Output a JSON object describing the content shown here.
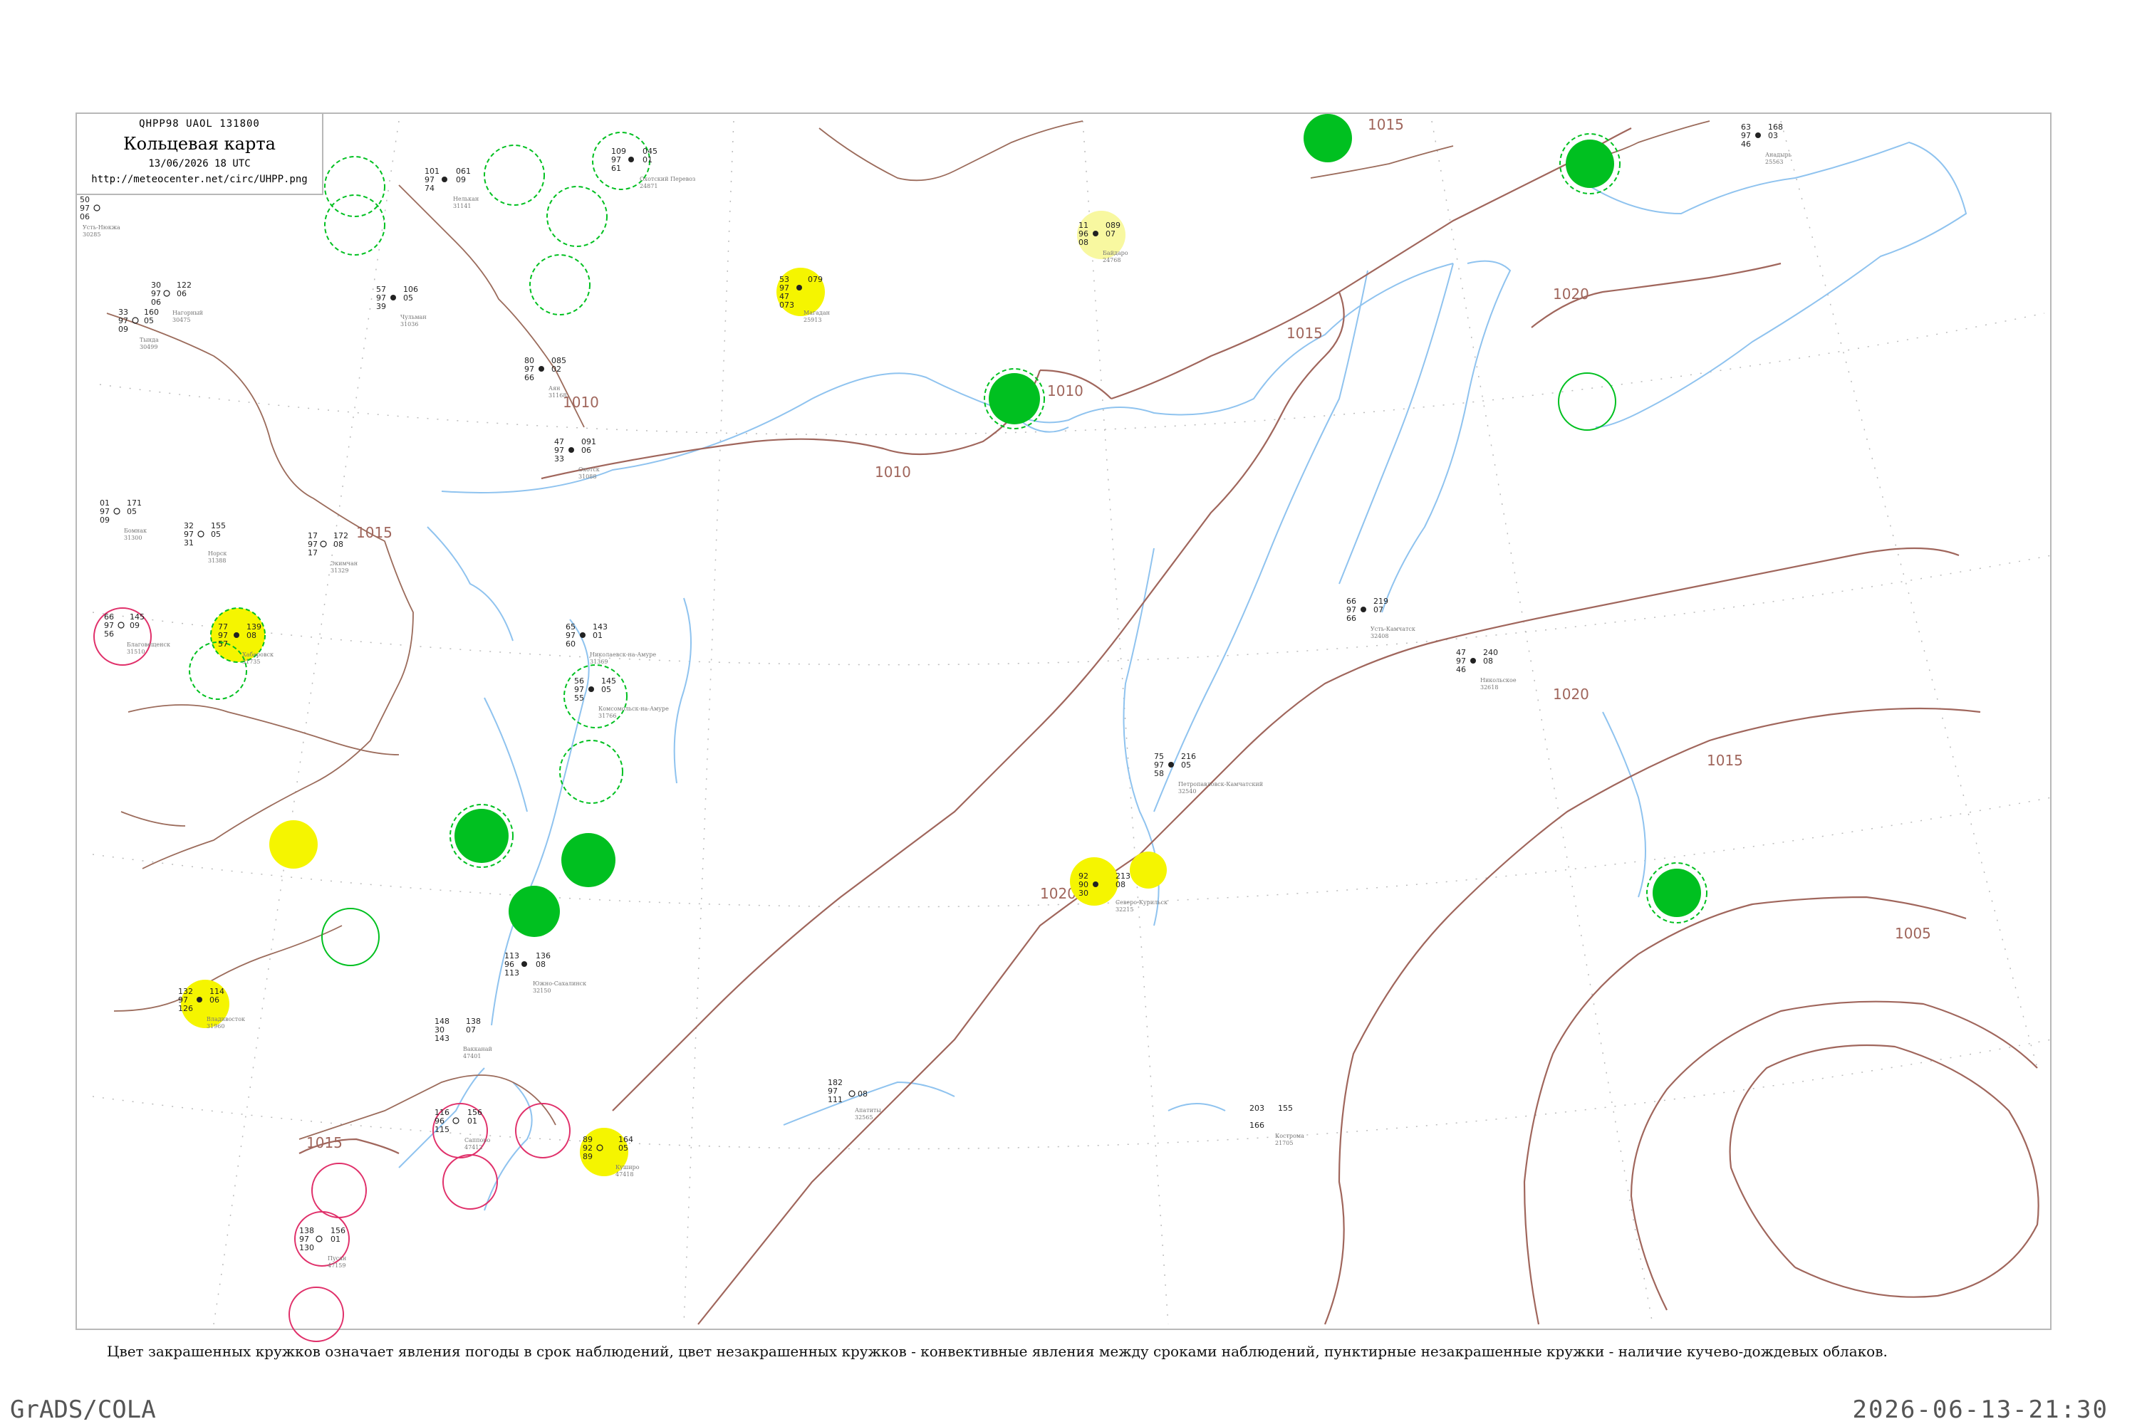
{
  "title": {
    "code": "QHPP98  UAOL  131800",
    "main": "Кольцевая карта",
    "date": "13/06/2026 18 UTC",
    "url": "http://meteocenter.net/circ/UHPP.png"
  },
  "legend_note": "Цвет закрашенных кружков означает явления погоды в срок наблюдений, цвет незакрашенных кружков - конвективные явления между сроками наблюдений, пунктирные незакрашенные кружки - наличие кучево-дождевых облаков.",
  "footer": {
    "left": "GrADS/COLA",
    "right": "2026-06-13-21:30"
  },
  "colors": {
    "isobar": "#a0665c",
    "coast": "#8fc3ef",
    "rain": "#00c020",
    "fog": "#f5f500",
    "haze": "#f8f8a0",
    "thunder": "#e0306a",
    "grid": "#aaaaaa"
  },
  "isobar_labels": [
    "1010",
    "1010",
    "1010",
    "1015",
    "1015",
    "1015",
    "1020",
    "1020",
    "1020",
    "1005",
    "1015",
    "1015"
  ],
  "stations": [
    {
      "name": "Усть-Нюкжа",
      "id": "30285",
      "vals": [
        "50",
        "97",
        "06"
      ],
      "mark": "none"
    },
    {
      "name": "Тында",
      "id": "30499",
      "vals": [
        "33",
        "97",
        "09",
        "160",
        "05"
      ],
      "mark": "none"
    },
    {
      "name": "Нагорный",
      "id": "30475",
      "vals": [
        "30",
        "97",
        "06",
        "122",
        "06"
      ],
      "mark": "none"
    },
    {
      "name": "Нелькан",
      "id": "31141",
      "vals": [
        "101",
        "97",
        "74",
        "061",
        "09"
      ],
      "mark": "none"
    },
    {
      "name": "Чульман",
      "id": "31036",
      "vals": [
        "57",
        "97",
        "39",
        "106",
        "05"
      ],
      "mark": "none"
    },
    {
      "name": "Аян",
      "id": "31168",
      "vals": [
        "80",
        "97",
        "66",
        "085",
        "02"
      ],
      "mark": "none"
    },
    {
      "name": "Охотск",
      "id": "31088",
      "vals": [
        "47",
        "97",
        "33",
        "091",
        "06"
      ],
      "mark": "none"
    },
    {
      "name": "Магадан",
      "id": "25913",
      "vals": [
        "53",
        "97",
        "47",
        "079",
        "073"
      ],
      "mark": "fog"
    },
    {
      "name": "Байдаро",
      "id": "24768",
      "vals": [
        "11",
        "96",
        "08",
        "089",
        "07"
      ],
      "mark": "haze"
    },
    {
      "name": "Экимчан",
      "id": "31329",
      "vals": [
        "17",
        "97",
        "17",
        "172",
        "08"
      ],
      "mark": "none"
    },
    {
      "name": "Бомнак",
      "id": "31300",
      "vals": [
        "01",
        "97",
        "09",
        "171",
        "05"
      ],
      "mark": "none"
    },
    {
      "name": "Норск",
      "id": "31388",
      "vals": [
        "32",
        "97",
        "31",
        "155",
        "05"
      ],
      "mark": "none"
    },
    {
      "name": "Благовещенск",
      "id": "31510",
      "vals": [
        "66",
        "97",
        "56",
        "145",
        "09"
      ],
      "mark": "thunder"
    },
    {
      "name": "Хабаровск",
      "id": "31735",
      "vals": [
        "77",
        "97",
        "57",
        "139",
        "08"
      ],
      "mark": "rain"
    },
    {
      "name": "Николаевск-на-Амуре",
      "id": "31369",
      "vals": [
        "65",
        "97",
        "60",
        "143",
        "01"
      ],
      "mark": "none"
    },
    {
      "name": "Комсомольск-на-Амуре",
      "id": "31766",
      "vals": [
        "56",
        "97",
        "55",
        "145",
        "05"
      ],
      "mark": "rain"
    },
    {
      "name": "Южно-Сахалинск",
      "id": "32150",
      "vals": [
        "113",
        "96",
        "113",
        "136",
        "08"
      ],
      "mark": "none"
    },
    {
      "name": "Владивосток",
      "id": "31960",
      "vals": [
        "132",
        "97",
        "126",
        "114",
        "06"
      ],
      "mark": "fog"
    },
    {
      "name": "Охотский Перевоз",
      "id": "24871",
      "vals": [
        "109",
        "97",
        "61",
        "045",
        "01"
      ],
      "mark": "none"
    },
    {
      "name": "Северо-Курильск",
      "id": "32215",
      "vals": [
        "92",
        "90",
        "30",
        "213",
        "08"
      ],
      "mark": "fog"
    },
    {
      "name": "Усть-Камчатск",
      "id": "32408",
      "vals": [
        "66",
        "97",
        "66",
        "219",
        "07"
      ],
      "mark": "none"
    },
    {
      "name": "Петропавловск-Камчатский",
      "id": "32540",
      "vals": [
        "75",
        "97",
        "58",
        "216",
        "05"
      ],
      "mark": "none"
    },
    {
      "name": "Никольское",
      "id": "32618",
      "vals": [
        "47",
        "97",
        "46",
        "240",
        "08"
      ],
      "mark": "none"
    },
    {
      "name": "Анадырь",
      "id": "25563",
      "vals": [
        "63",
        "97",
        "46",
        "168",
        "03"
      ],
      "mark": "none"
    },
    {
      "name": "Вакканай",
      "id": "47401",
      "vals": [
        "148",
        "30",
        "143",
        "138",
        "07"
      ],
      "mark": "none"
    },
    {
      "name": "Саппоро",
      "id": "47412",
      "vals": [
        "116",
        "96",
        "115",
        "156",
        "01"
      ],
      "mark": "thunder"
    },
    {
      "name": "Куширо",
      "id": "47418",
      "vals": [
        "89",
        "92",
        "89",
        "164",
        "05"
      ],
      "mark": "fog"
    },
    {
      "name": "Пусан",
      "id": "47159",
      "vals": [
        "138",
        "97",
        "130",
        "156",
        "01"
      ],
      "mark": "thunder"
    },
    {
      "name": "Апатиты",
      "id": "32565",
      "vals": [
        "182",
        "97",
        "111",
        "08"
      ],
      "mark": "none"
    },
    {
      "name": "Кострома",
      "id": "21705",
      "vals": [
        "203",
        "166",
        "155"
      ],
      "mark": "none"
    }
  ]
}
